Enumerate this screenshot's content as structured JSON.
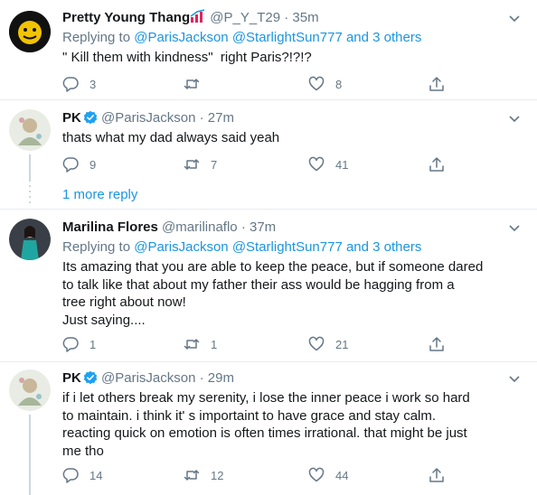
{
  "tweets": [
    {
      "name": "Pretty Young Thang",
      "handle": "@P_Y_T29",
      "time": "35m",
      "replying_prefix": "Replying to",
      "replying_users": "@ParisJackson @StarlightSun777",
      "replying_and": "and 3 others",
      "text": "\" Kill them with kindness\"  right Paris?!?!?",
      "replies": "3",
      "retweets": "",
      "likes": "8"
    },
    {
      "name": "PK",
      "handle": "@ParisJackson",
      "time": "27m",
      "text": "thats what my dad always said yeah",
      "replies": "9",
      "retweets": "7",
      "likes": "41"
    },
    {
      "name": "Marilina Flores",
      "handle": "@marilinaflo",
      "time": "37m",
      "replying_prefix": "Replying to",
      "replying_users": "@ParisJackson @StarlightSun777",
      "replying_and": "and 3 others",
      "text": "Its amazing that you are able to keep the peace, but if someone dared\nto talk like that about my father their ass would be hagging from a\ntree right about now!\nJust saying....",
      "replies": "1",
      "retweets": "1",
      "likes": "21"
    },
    {
      "name": "PK",
      "handle": "@ParisJackson",
      "time": "29m",
      "text": "if i let others break my serenity, i lose the inner peace i work so hard\nto maintain. i think it' s importaint to have grace and stay calm.\nreacting quick on emotion is often times irrational. that might be just\nme tho",
      "replies": "14",
      "retweets": "12",
      "likes": "44"
    }
  ],
  "more_reply_label": "1 more reply",
  "dot_separator": "·",
  "colors": {
    "link": "#1b95e0",
    "muted": "#657786",
    "divider": "#e6ecf0",
    "thread": "#ccd6dd"
  }
}
